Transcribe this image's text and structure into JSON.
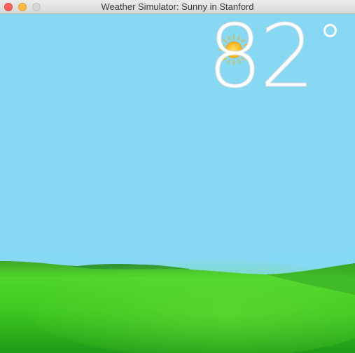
{
  "window": {
    "title": "Weather Simulator: Sunny in Stanford"
  },
  "weather": {
    "temperature": "82",
    "condition_icon": "sun-icon"
  },
  "colors": {
    "sky": "#87d8f2",
    "grass_light": "#4fd62a",
    "grass_dark": "#1e9a18",
    "temperature_text": "#ffffff",
    "sun": "#fcc02a"
  }
}
